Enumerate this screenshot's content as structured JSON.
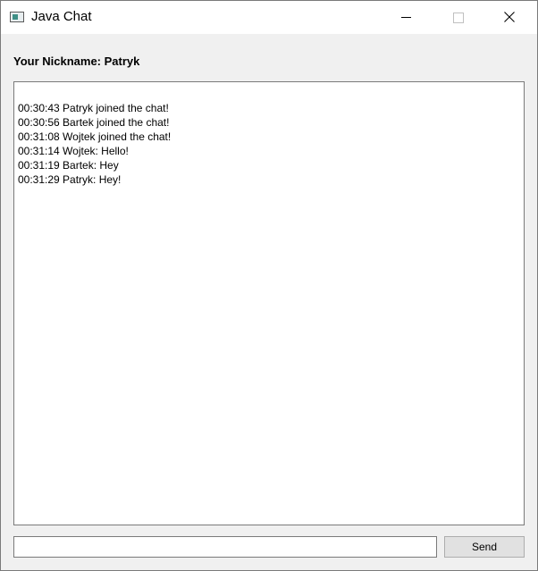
{
  "window": {
    "title": "Java Chat",
    "icon": "java-app-icon",
    "controls": {
      "minimize_icon": "minimize-icon",
      "maximize_icon": "maximize-icon",
      "close_icon": "close-icon"
    }
  },
  "header": {
    "nickname_label": "Your Nickname: Patryk"
  },
  "chat": {
    "messages": [
      "00:30:43 Patryk joined the chat!",
      "00:30:56 Bartek joined the chat!",
      "00:31:08 Wojtek joined the chat!",
      "00:31:14 Wojtek: Hello!",
      "00:31:19 Bartek: Hey",
      "00:31:29 Patryk: Hey!"
    ]
  },
  "composer": {
    "input_value": "",
    "send_label": "Send"
  }
}
